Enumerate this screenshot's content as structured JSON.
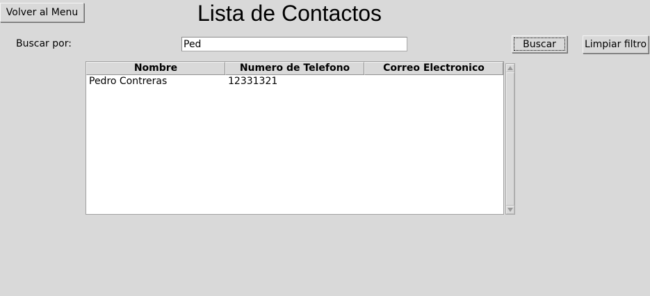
{
  "header": {
    "back_label": "Volver al Menu",
    "title": "Lista de Contactos"
  },
  "search": {
    "label": "Buscar por:",
    "value": "Ped",
    "search_label": "Buscar",
    "clear_label": "Limpiar filtro"
  },
  "table": {
    "columns": [
      "Nombre",
      "Numero de Telefono",
      "Correo Electronico"
    ],
    "rows": [
      [
        "Pedro Contreras",
        "12331321",
        ""
      ]
    ]
  }
}
